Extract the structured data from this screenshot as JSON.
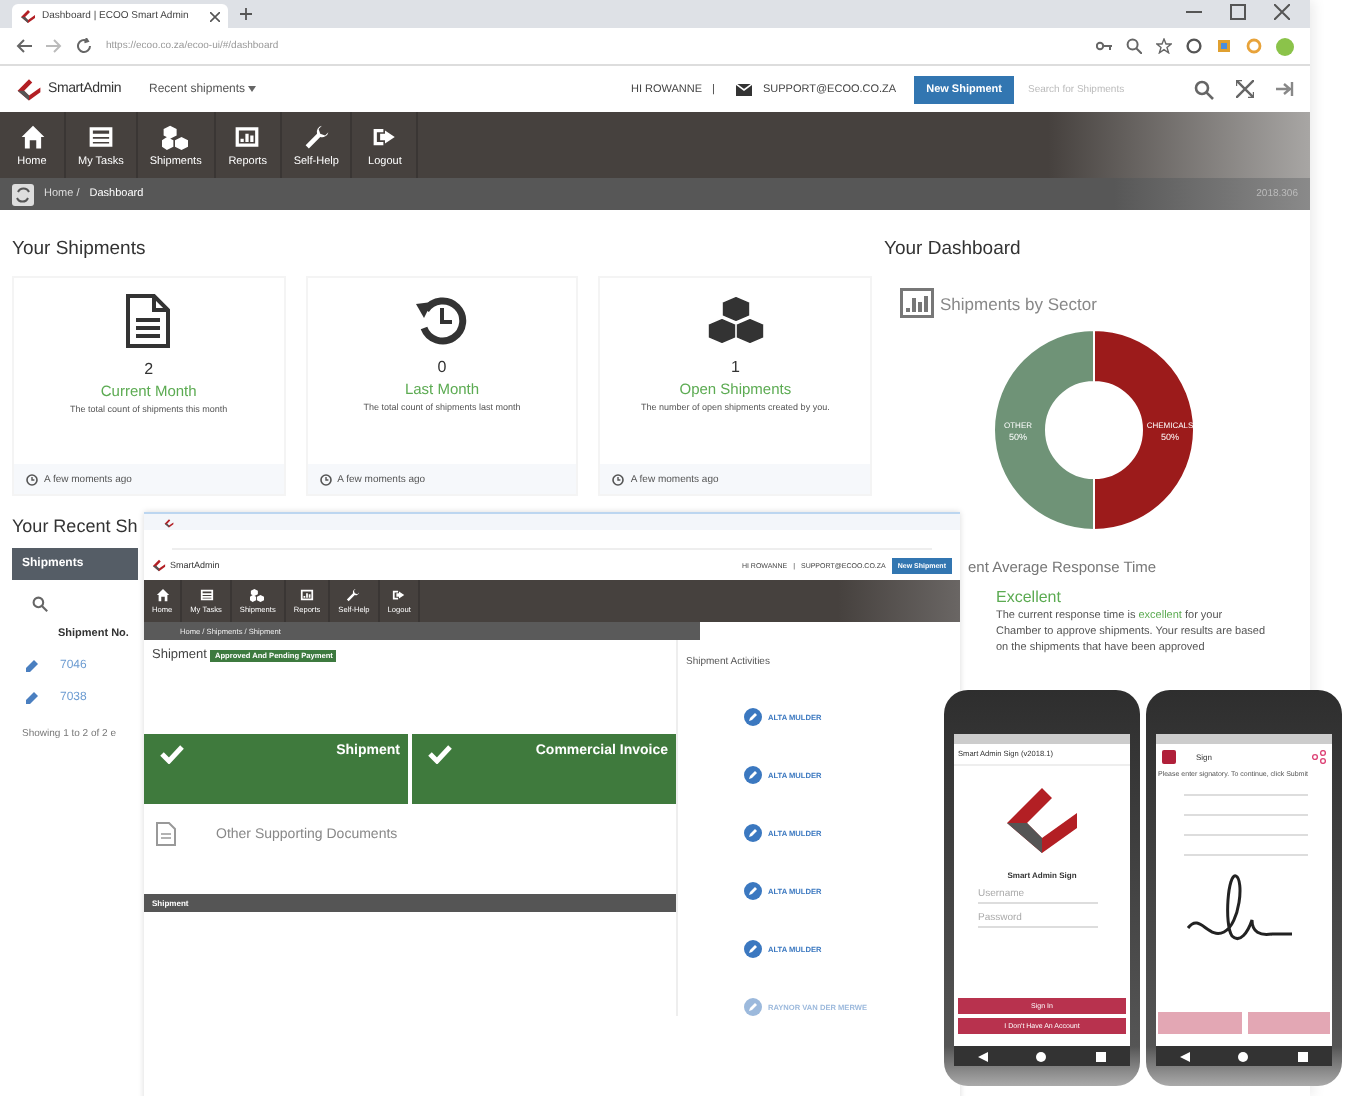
{
  "browser": {
    "tab_title": "Dashboard | ECOO Smart Admin",
    "url": "https://ecoo.co.za/ecoo-ui/#/dashboard"
  },
  "header": {
    "logo": "SmartAdmin",
    "dropdown": "Recent shipments",
    "greeting": "HI ROWANNE",
    "separator": "|",
    "support_email": "SUPPORT@ECOO.CO.ZA",
    "new_button": "New Shipment",
    "search": {
      "placeholder": "Search for Shipments"
    }
  },
  "nav": [
    {
      "kind": "home",
      "label": "Home"
    },
    {
      "kind": "tasks",
      "label": "My Tasks"
    },
    {
      "kind": "shipments",
      "label": "Shipments"
    },
    {
      "kind": "reports",
      "label": "Reports"
    },
    {
      "kind": "help",
      "label": "Self-Help"
    },
    {
      "kind": "logout",
      "label": "Logout"
    }
  ],
  "breadcrumb": {
    "items": [
      "Home /",
      "Dashboard"
    ],
    "version": "2018.306"
  },
  "shipments_section": {
    "title": "Your Shipments",
    "cards": [
      {
        "kind": "document",
        "count": "2",
        "label": "Current Month",
        "description": "The total count of shipments this month",
        "footer": "A few moments ago"
      },
      {
        "kind": "history",
        "count": "0",
        "label": "Last Month",
        "description": "The total count of shipments last month",
        "footer": "A few moments ago"
      },
      {
        "kind": "cubes",
        "count": "1",
        "label": "Open Shipments",
        "description": "The number of open shipments created by you.",
        "footer": "A few moments ago"
      }
    ]
  },
  "dashboard": {
    "title": "Your Dashboard",
    "chart_title": "Shipments by Sector",
    "chart_data": {
      "type": "donut",
      "categories": [
        "OTHER",
        "CHEMICALS"
      ],
      "values": [
        50,
        50
      ],
      "value_labels": [
        "50%",
        "50%"
      ]
    }
  },
  "recent": {
    "title": "Your Recent Sh",
    "panel_title": "Shipments",
    "column": "Shipment No.",
    "rows": [
      {
        "number": "7046"
      },
      {
        "number": "7038"
      }
    ],
    "footer": "Showing 1 to 2 of 2 e"
  },
  "response": {
    "title": "ent Average Response Time",
    "rating": "Excellent",
    "before": "The current response time is ",
    "highlight": "excellent",
    "after": " for your Chamber to approve shipments. Your results are based on the shipments that have been approved"
  },
  "overlay": {
    "header": {
      "logo": "SmartAdmin",
      "greeting": "HI ROWANNE",
      "separator": "|",
      "support_email": "SUPPORT@ECOO.CO.ZA",
      "new_button": "New Shipment"
    },
    "nav": [
      {
        "kind": "home",
        "label": "Home"
      },
      {
        "kind": "tasks",
        "label": "My Tasks"
      },
      {
        "kind": "shipments",
        "label": "Shipments"
      },
      {
        "kind": "reports",
        "label": "Reports"
      },
      {
        "kind": "help",
        "label": "Self-Help"
      },
      {
        "kind": "logout",
        "label": "Logout"
      }
    ],
    "breadcrumb": "Home / Shipments / Shipment",
    "title": "Shipment",
    "badge": "Approved And Pending Payment",
    "tiles": [
      {
        "label": "Shipment"
      },
      {
        "label": "Commercial Invoice"
      }
    ],
    "other_documents": "Other Supporting Documents",
    "section_title": "Shipment",
    "activities_title": "Shipment Activities",
    "activities": [
      {
        "author": "ALTA MULDER"
      },
      {
        "author": "ALTA MULDER"
      },
      {
        "author": "ALTA MULDER"
      },
      {
        "author": "ALTA MULDER"
      },
      {
        "author": "ALTA MULDER"
      },
      {
        "author": "RAYNOR VAN DER MERWE"
      }
    ]
  },
  "phones": [
    {
      "kind": "login",
      "title": "Smart Admin Sign (v2018.1)",
      "app_name": "Smart Admin Sign",
      "fields": [
        {
          "placeholder": "Username"
        },
        {
          "placeholder": "Password"
        }
      ],
      "buttons": [
        "Sign In",
        "I Don't Have An Account"
      ]
    },
    {
      "kind": "sign",
      "title": "Sign",
      "prompt": "Please enter signatory. To continue, click Submit"
    }
  ]
}
